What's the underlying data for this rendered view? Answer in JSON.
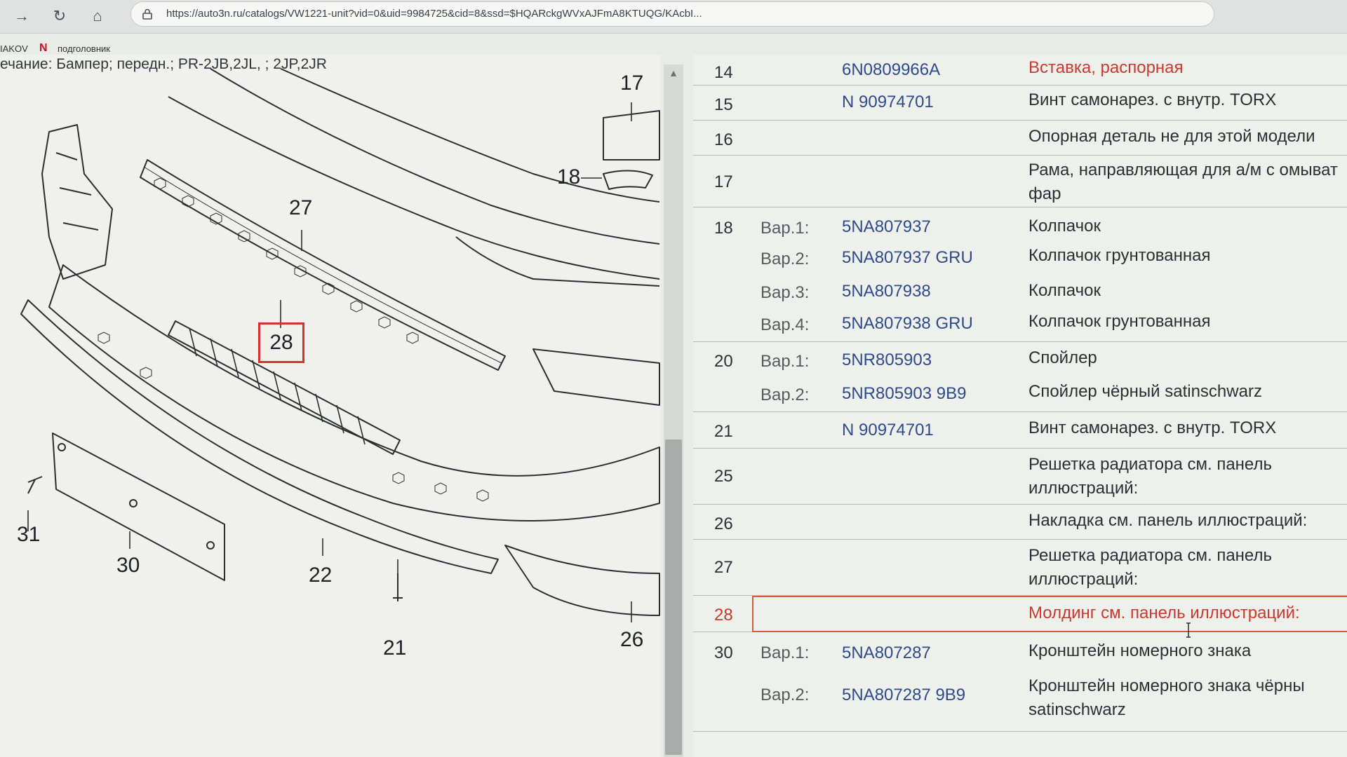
{
  "browser": {
    "url": "https://auto3n.ru/catalogs/VW1221-unit?vid=0&uid=9984725&cid=8&ssd=$HQARckgWVxAJFmA8KTUQG/KAcbI...",
    "bookmarks": [
      "IAKOV",
      "подголовник"
    ]
  },
  "diagram": {
    "note": "ечание: Бампер; передн.; PR-2JB,2JL, ; 2JP,2JR",
    "callouts": [
      "17",
      "18",
      "27",
      "28",
      "31",
      "30",
      "22",
      "21",
      "26"
    ],
    "highlighted": "28"
  },
  "parts": [
    {
      "num": "14",
      "variant": "",
      "code": "6N0809966A",
      "desc": "Вставка, распорная",
      "highlight": true
    },
    {
      "num": "15",
      "variant": "",
      "code": "N 90974701",
      "desc": "Винт самонарез. с внутр. TORX"
    },
    {
      "num": "16",
      "variant": "",
      "code": "",
      "desc": "Опорная деталь не для этой модели"
    },
    {
      "num": "17",
      "variant": "",
      "code": "",
      "desc": "Рама, направляющая для а/м с омыват фар"
    },
    {
      "num": "18",
      "variant": "Вар.1:",
      "code": "5NA807937",
      "desc": "Колпачок"
    },
    {
      "num": "",
      "variant": "Вар.2:",
      "code": "5NA807937 GRU",
      "desc": "Колпачок грунтованная"
    },
    {
      "num": "",
      "variant": "Вар.3:",
      "code": "5NA807938",
      "desc": "Колпачок"
    },
    {
      "num": "",
      "variant": "Вар.4:",
      "code": "5NA807938 GRU",
      "desc": "Колпачок грунтованная"
    },
    {
      "num": "20",
      "variant": "Вар.1:",
      "code": "5NR805903",
      "desc": "Спойлер"
    },
    {
      "num": "",
      "variant": "Вар.2:",
      "code": "5NR805903 9B9",
      "desc": "Спойлер чёрный satinschwarz"
    },
    {
      "num": "21",
      "variant": "",
      "code": "N 90974701",
      "desc": "Винт самонарез. с внутр. TORX"
    },
    {
      "num": "25",
      "variant": "",
      "code": "",
      "desc": "Решетка радиатора см. панель иллюстраций:"
    },
    {
      "num": "26",
      "variant": "",
      "code": "",
      "desc": "Накладка см. панель иллюстраций:"
    },
    {
      "num": "27",
      "variant": "",
      "code": "",
      "desc": "Решетка радиатора см. панель иллюстраций:"
    },
    {
      "num": "28",
      "variant": "",
      "code": "",
      "desc": "Молдинг см. панель иллюстраций:",
      "selected": true
    },
    {
      "num": "30",
      "variant": "Вар.1:",
      "code": "5NA807287",
      "desc": "Кронштейн номерного знака"
    },
    {
      "num": "",
      "variant": "Вар.2:",
      "code": "5NA807287 9B9",
      "desc": "Кронштейн номерного знака чёрны satinschwarz"
    }
  ],
  "colors": {
    "accent_red": "#c83a30",
    "code_blue": "#2e4a8a",
    "selection_border": "#d65a3a"
  }
}
